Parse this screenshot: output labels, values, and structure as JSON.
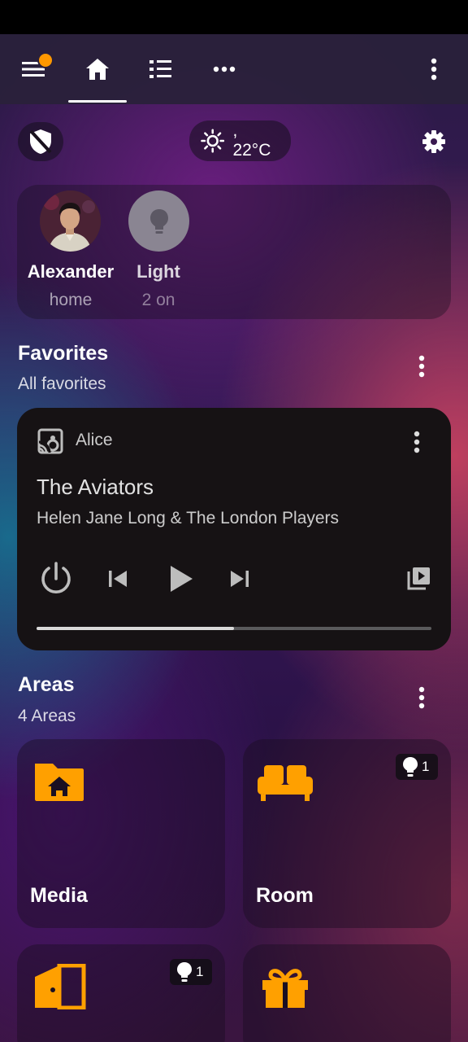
{
  "colors": {
    "accent": "#ff9800",
    "card_dark": "#161214",
    "progress_fill": "#d9d9d9",
    "progress_track": "#5a5a5c"
  },
  "topbar": {
    "menu_icon": "menu-icon",
    "tabs": [
      {
        "icon": "home-icon",
        "active": true
      },
      {
        "icon": "list-icon",
        "active": false
      },
      {
        "icon": "more-horizontal-icon",
        "active": false
      }
    ],
    "overflow_icon": "more-vertical-icon"
  },
  "header": {
    "alarm_icon": "shield-off-icon",
    "weather_icon": "sunny-icon",
    "weather_text": ", 22°C",
    "settings_icon": "gear-icon"
  },
  "badges": [
    {
      "name": "Alexander",
      "state": "home"
    },
    {
      "name": "Light",
      "state": "2 on"
    }
  ],
  "favorites": {
    "title": "Favorites",
    "subtitle": "All favorites",
    "media": {
      "player": "Alice",
      "title": "The Aviators",
      "artist": "Helen Jane Long & The London Players",
      "progress": 0.5
    }
  },
  "areas": {
    "title": "Areas",
    "subtitle": "4 Areas",
    "items": [
      {
        "name": "Media",
        "icon": "folder-home-icon",
        "lights": ""
      },
      {
        "name": "Room",
        "icon": "sofa-icon",
        "lights": "1"
      },
      {
        "name": "",
        "icon": "door-icon",
        "lights": "1"
      },
      {
        "name": "",
        "icon": "gift-icon",
        "lights": ""
      }
    ]
  }
}
